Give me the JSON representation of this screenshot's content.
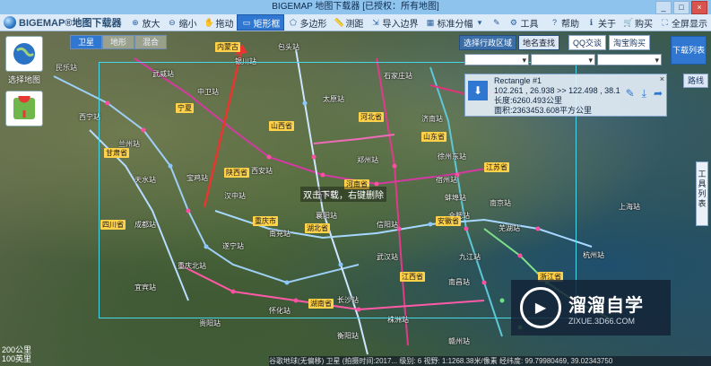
{
  "window": {
    "title": "BIGEMAP 地图下载器 [已授权：所有地图]",
    "controls": [
      "_",
      "□",
      "×"
    ]
  },
  "toolbar": {
    "logo_text": "BIGEMAP®地图下载器",
    "items": [
      {
        "label": "放大",
        "icon": "zoom-in-icon"
      },
      {
        "label": "缩小",
        "icon": "zoom-out-icon"
      },
      {
        "label": "拖动",
        "icon": "hand-icon"
      },
      {
        "label": "矩形框",
        "icon": "rectangle-icon",
        "active": true
      },
      {
        "label": "多边形",
        "icon": "polygon-icon"
      },
      {
        "label": "测距",
        "icon": "ruler-icon"
      },
      {
        "label": "导入边界",
        "icon": "import-icon"
      },
      {
        "label": "标准分幅",
        "icon": "grid-icon"
      },
      {
        "label": "",
        "icon": "eyedropper-icon"
      },
      {
        "label": "工具",
        "icon": "gear-icon"
      }
    ],
    "right_items": [
      {
        "label": "帮助",
        "icon": "help-icon"
      },
      {
        "label": "关于",
        "icon": "info-icon"
      },
      {
        "label": "购买",
        "icon": "cart-icon"
      },
      {
        "label": "全屏显示",
        "icon": "fullscreen-icon"
      }
    ]
  },
  "map_types": [
    "卫星",
    "地形",
    "混合"
  ],
  "left_panel": {
    "select_map_label": "选择地图"
  },
  "right_panel": {
    "tab_region": "选择行政区域",
    "tab_search": "地名查找",
    "qq_label": "QQ交谈",
    "taobao_label": "淘宝购买",
    "download_list": "下载列表",
    "route_btn": "路线",
    "selects": [
      "",
      "",
      ""
    ],
    "info": {
      "name": "Rectangle #1",
      "coords": "102.261 , 26.938 >> 122.498 , 38.1",
      "length": "长度:6260.493公里",
      "area": "面积:2363453.608平方公里"
    }
  },
  "tools_tab": "工具列表",
  "selection_hint": "双击下载，右键删除",
  "scale": {
    "line1": "200公里",
    "line2": "100英里"
  },
  "status": "谷歌地球(无偏移) 卫星 (拍摄时间:2017... 级别: 6  视野: 1:1268.38米/像素   经纬度: 99.79980469, 39.02343750",
  "watermark": {
    "title": "溜溜自学",
    "url": "ZIXUE.3D66.COM"
  },
  "labels": {
    "stations": [
      "民乐站",
      "西宁站",
      "兰州站",
      "武威站",
      "中卫站",
      "银川站",
      "包头站",
      "太原站",
      "石家庄站",
      "济南站",
      "郑州站",
      "西安站",
      "洛阳站",
      "徐州东站",
      "南京站",
      "合肥站",
      "武汉站",
      "长沙站",
      "重庆北站",
      "成都站",
      "贵阳站",
      "遂宁站",
      "南充站",
      "宜宾站",
      "怀化站",
      "衡阳站",
      "上海站",
      "杭州站",
      "南昌站",
      "株洲站",
      "赣州站",
      "汉中站",
      "天水站",
      "宝鸡站",
      "襄阳站",
      "信阳站",
      "九江站",
      "芜湖站",
      "宿州站",
      "蚌埠站"
    ],
    "cities": [
      "陕西省",
      "河南省",
      "湖北省",
      "江苏省",
      "重庆市",
      "四川省",
      "湖南省",
      "安徽省",
      "江西省",
      "浙江省",
      "甘肃省",
      "宁夏",
      "内蒙古",
      "山西省",
      "河北省",
      "山东省"
    ]
  }
}
